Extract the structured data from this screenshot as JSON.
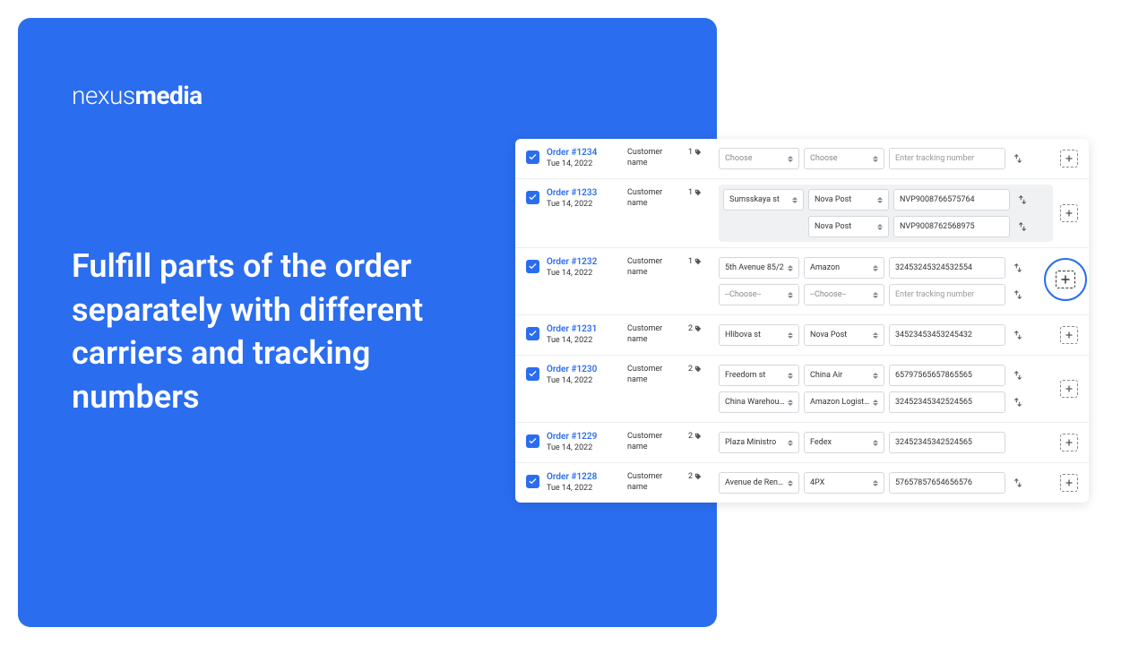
{
  "logo": {
    "thin": "nexus",
    "bold": "media"
  },
  "headline": "Fulfill parts of the order separately with different carriers and tracking numbers",
  "placeholder_tracking": "Enter tracking number",
  "rows": [
    {
      "order_id": "Order #1234",
      "date": "Tue 14, 2022",
      "customer": "Customer name",
      "qty": "1",
      "grouped": false,
      "shipments": [
        {
          "addr": "Choose",
          "addr_ph": true,
          "carrier": "Choose",
          "carrier_ph": true,
          "tracking": "",
          "swap": true
        }
      ]
    },
    {
      "order_id": "Order #1233",
      "date": "Tue 14, 2022",
      "customer": "Customer name",
      "qty": "1",
      "grouped": true,
      "shipments": [
        {
          "addr": "Sumsskaya st",
          "carrier": "Nova Post",
          "tracking": "NVP9008766575764",
          "swap": true
        },
        {
          "addr": "",
          "carrier": "Nova Post",
          "tracking": "NVP9008762568975",
          "swap": true
        }
      ]
    },
    {
      "order_id": "Order #1232",
      "date": "Tue 14, 2022",
      "customer": "Customer name",
      "qty": "1",
      "grouped": false,
      "shipments": [
        {
          "addr": "5th Avenue 85/2",
          "carrier": "Amazon",
          "tracking": "32453245324532554",
          "swap": true
        },
        {
          "addr": "--Choose--",
          "addr_ph": true,
          "carrier": "--Choose--",
          "carrier_ph": true,
          "tracking": "",
          "swap": true
        }
      ]
    },
    {
      "order_id": "Order #1231",
      "date": "Tue 14, 2022",
      "customer": "Customer name",
      "qty": "2",
      "grouped": false,
      "shipments": [
        {
          "addr": "Hlibova st",
          "carrier": "Nova Post",
          "tracking": "34523453453245432",
          "swap": true
        }
      ]
    },
    {
      "order_id": "Order #1230",
      "date": "Tue 14, 2022",
      "customer": "Customer name",
      "qty": "2",
      "grouped": false,
      "shipments": [
        {
          "addr": "Freedom st",
          "carrier": "China Air",
          "tracking": "65797565657865565",
          "swap": true
        },
        {
          "addr": "China Warehouse",
          "carrier": "Amazon Logistics",
          "tracking": "32452345342524565",
          "swap": true
        }
      ]
    },
    {
      "order_id": "Order #1229",
      "date": "Tue 14, 2022",
      "customer": "Customer name",
      "qty": "2",
      "grouped": false,
      "shipments": [
        {
          "addr": "Plaza Ministro",
          "carrier": "Fedex",
          "tracking": "32452345342524565",
          "swap": false
        }
      ]
    },
    {
      "order_id": "Order #1228",
      "date": "Tue 14, 2022",
      "customer": "Customer name",
      "qty": "2",
      "grouped": false,
      "shipments": [
        {
          "addr": "Avenue de Rena..",
          "carrier": "4PX",
          "tracking": "57657857654656576",
          "swap": true
        }
      ]
    }
  ]
}
